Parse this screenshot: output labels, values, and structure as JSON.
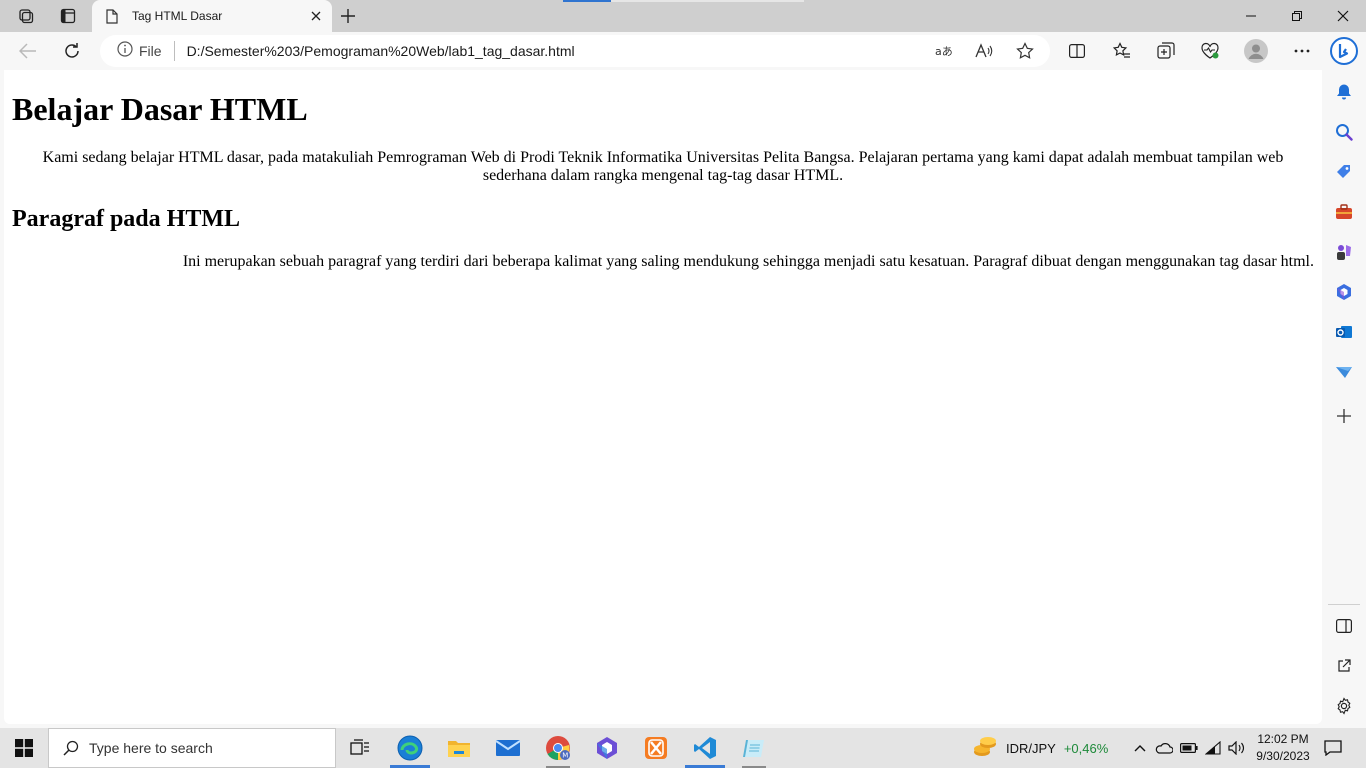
{
  "browser": {
    "tab": {
      "title": "Tag HTML Dasar"
    },
    "address_bar": {
      "site_info_label": "File",
      "url": "D:/Semester%203/Pemograman%20Web/lab1_tag_dasar.html"
    },
    "icons": {
      "workspaces": "workspaces-icon",
      "tab_actions": "tab-actions-icon",
      "new_tab": "plus-icon",
      "back": "back-arrow-icon",
      "refresh": "refresh-icon",
      "read_aloud": "read-aloud-icon",
      "translate": "translate-icon",
      "favorite": "star-icon",
      "split_screen": "split-screen-icon",
      "favorites": "favorites-icon",
      "collections": "collections-icon",
      "browser_essentials": "heart-pulse-icon",
      "profile": "profile-avatar",
      "more": "more-dots-icon",
      "copilot": "bing-copilot-icon"
    }
  },
  "page": {
    "heading1": "Belajar Dasar HTML",
    "paragraph1": "Kami sedang belajar HTML dasar, pada matakuliah Pemrograman Web di Prodi Teknik Informatika Universitas Pelita Bangsa. Pelajaran pertama yang kami dapat adalah membuat tampilan web sederhana dalam rangka mengenal tag-tag dasar HTML.",
    "heading2": "Paragraf pada HTML",
    "paragraph2": "Ini merupakan sebuah paragraf yang terdiri dari beberapa kalimat yang saling mendukung sehingga menjadi satu kesatuan. Paragraf dibuat dengan menggunakan tag dasar html."
  },
  "sidebar": {
    "items": [
      "bell-icon",
      "search-icon",
      "shopping-tag-icon",
      "toolbox-icon",
      "games-icon",
      "microsoft365-icon",
      "outlook-icon",
      "drop-icon",
      "add-icon"
    ],
    "bottom": [
      "sidebar-toggle-icon",
      "external-link-icon",
      "settings-icon"
    ]
  },
  "taskbar": {
    "search_placeholder": "Type here to search",
    "apps": [
      "task-view-icon",
      "edge-icon",
      "file-explorer-icon",
      "mail-icon",
      "chrome-icon",
      "copilot-app-icon",
      "xampp-icon",
      "vscode-icon",
      "notepad-icon"
    ],
    "widget": {
      "label": "IDR/JPY",
      "change": "+0,46%"
    },
    "clock": {
      "time": "12:02 PM",
      "date": "9/30/2023"
    }
  },
  "colors": {
    "accent": "#2f74d0",
    "positive": "#1e8a3a",
    "tab_strip": "#cfcfcf"
  }
}
